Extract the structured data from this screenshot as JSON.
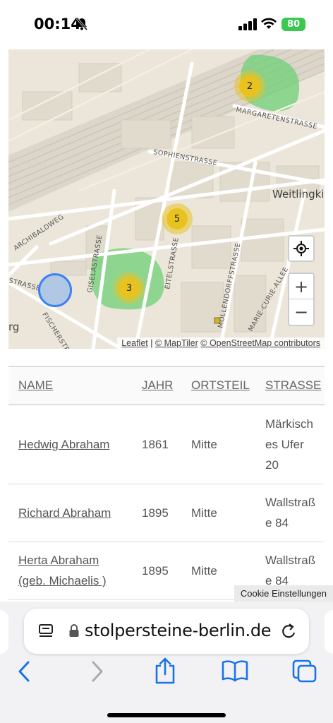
{
  "status": {
    "time": "00:14",
    "battery": "80"
  },
  "map": {
    "clusters": [
      {
        "count": "2"
      },
      {
        "count": "5"
      },
      {
        "count": "3"
      }
    ],
    "street_labels": [
      "MARGARETENSTRASSE",
      "SOPHIENSTRASSE",
      "ARCHIBALDWEG",
      "GISELASTRASSE",
      "EITELSTRASSE",
      "MÖLLENDORFFSTRASSE",
      "MARIE-CURIE-ALLEE",
      "FISCHERSTR",
      "Weitlingki",
      "STRASSE",
      "rg"
    ],
    "zoom_in": "+",
    "zoom_out": "−",
    "attribution": {
      "leaflet": "Leaflet",
      "maptiler": "© MapTiler",
      "osm": "© OpenStreetMap contributors"
    }
  },
  "table": {
    "headers": {
      "name": "NAME",
      "year": "JAHR",
      "district": "ORTSTEIL",
      "street": "STRASSE"
    },
    "rows": [
      {
        "name": "Hedwig Abraham",
        "name2": "",
        "year": "1861",
        "district": "Mitte",
        "street1": "Märkisch",
        "street2": "es Ufer",
        "street3": "20"
      },
      {
        "name": "Richard Abraham",
        "name2": "",
        "year": "1895",
        "district": "Mitte",
        "street1": "Wallstraß",
        "street2": "e 84",
        "street3": ""
      },
      {
        "name": "Herta Abraham",
        "name2": "(geb. Michaelis )",
        "year": "1895",
        "district": "Mitte",
        "street1": "Wallstraß",
        "street2": "e 84",
        "street3": ""
      }
    ]
  },
  "cookie_label": "Cookie Einstellungen",
  "browser": {
    "url": "stolpersteine-berlin.de"
  },
  "colors": {
    "cluster": "#e8c31e",
    "cluster_area": "#5ec85e",
    "accent": "#1a73e8",
    "battery": "#3ac84f"
  }
}
